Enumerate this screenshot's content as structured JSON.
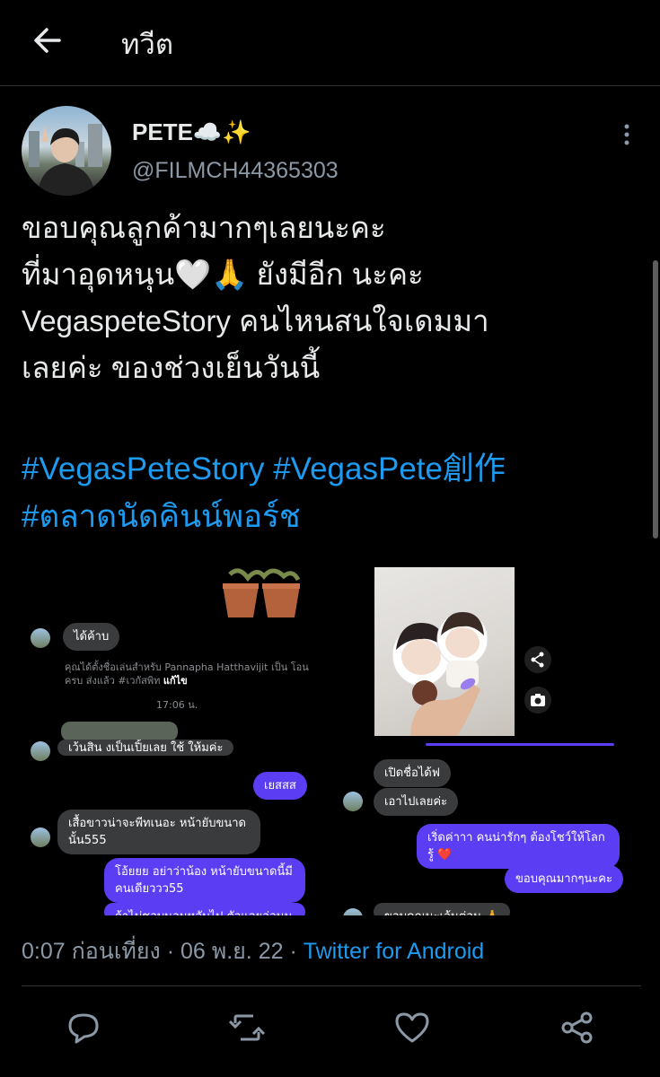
{
  "header": {
    "title": "ทวีต"
  },
  "tweet": {
    "author_name": "PETE☁️✨",
    "author_handle": "@FILMCH44365303",
    "text_lines": [
      "ขอบคุณลูกค้ามากๆเลยนะคะ",
      "ที่มาอุดหนุน🤍🙏 ยังมีอีก นะคะ",
      "VegaspeteStory คนไหนสนใจเดมมา",
      "เลยค่ะ ของช่วงเย็นวันนี้"
    ],
    "hashtags": [
      "#VegasPeteStory",
      "#VegasPete創作",
      "#ตลาดนัดคินน์พอร์ช"
    ],
    "time": "0:07 ก่อนเที่ยง",
    "date": "06 พ.ย. 22",
    "separator": "·",
    "source": "Twitter for Android"
  },
  "media": {
    "left_chat": {
      "msg1": "ได้ค้าบ",
      "system_text": "คุณได้ตั้งชื่อเล่นสำหรับ Pannapha Hatthavijit เป็น โอน ครบ ส่งแล้ว #เวกัสพิท",
      "system_link": "แก้ไข",
      "timestamp": "17:06 น.",
      "msg2_partial": "เว้นสิน งเป็นเปิ้ยเลย ใช้ ให้มค่ะ",
      "out1": "เยสสส",
      "msg3": "เสื้อขาวน่าจะพีทเนอะ หน้ายับขนาดนั้น555",
      "out2": "โอ้ยยย อย่าว่าน้อง หน้ายับขนาดนี้มี คนเดียววว55",
      "out3_partial": "ถ้าไม่ชอบนอนหลับไป ตัวแลยอ่อนน"
    },
    "right_chat": {
      "msg1": "เปิดชื่อได้ฟ",
      "msg2": "เอาไปเลยค่ะ",
      "out1": "เริ่ดค่าาา คนน่ารักๆ ต้องโชว์ให้โลกรู้ ❤️",
      "out2": "ขอบคุณมากๆนะคะ",
      "msg3_partial": "ขอบคุณนะเล้นต่อน 🙏"
    }
  },
  "actions": {
    "reply": "reply-icon",
    "retweet": "retweet-icon",
    "like": "heart-icon",
    "share": "share-icon"
  },
  "colors": {
    "accent": "#1d9bf0",
    "background": "#000000",
    "secondary_text": "#8b98a5",
    "messenger_out": "#5b3ef3"
  }
}
